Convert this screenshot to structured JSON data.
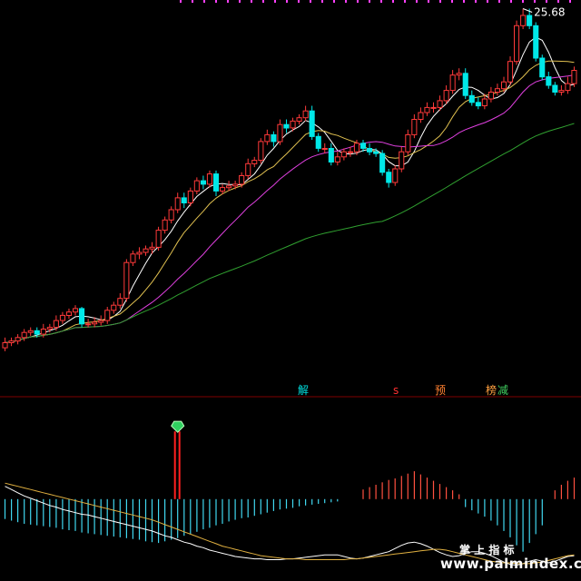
{
  "chart_data": [
    {
      "type": "candlestick",
      "title": "",
      "high_label": "25.68",
      "x": [
        1,
        2,
        3,
        4,
        5,
        6,
        7,
        8,
        9,
        10,
        11,
        12,
        13,
        14,
        15,
        16,
        17,
        18,
        19,
        20,
        21,
        22,
        23,
        24,
        25,
        26,
        27,
        28,
        29,
        30,
        31,
        32,
        33,
        34,
        35,
        36,
        37,
        38,
        39,
        40,
        41,
        42,
        43,
        44,
        45,
        46,
        47,
        48,
        49,
        50,
        51,
        52,
        53,
        54,
        55,
        56,
        57,
        58,
        59,
        60,
        61,
        62,
        63,
        64,
        65,
        66,
        67,
        68,
        69,
        70,
        71,
        72,
        73,
        74,
        75,
        76,
        77,
        78,
        79,
        80,
        81,
        82,
        83,
        84,
        85,
        86,
        87,
        88,
        89,
        90
      ],
      "series": [
        {
          "kind": "ohlc",
          "open": [
            9.4,
            9.7,
            9.8,
            10.0,
            10.3,
            10.4,
            10.2,
            10.5,
            10.6,
            11.0,
            11.3,
            11.5,
            11.7,
            10.8,
            10.8,
            10.9,
            11.0,
            11.6,
            11.9,
            12.3,
            14.4,
            14.9,
            15.0,
            15.2,
            15.3,
            16.3,
            16.9,
            17.5,
            18.2,
            17.9,
            18.6,
            19.2,
            19.0,
            19.6,
            18.6,
            18.8,
            18.9,
            19.0,
            19.5,
            20.2,
            20.4,
            21.5,
            21.9,
            21.5,
            22.5,
            22.3,
            22.7,
            22.9,
            23.3,
            21.8,
            21.1,
            21.1,
            20.3,
            20.6,
            20.9,
            20.9,
            21.4,
            21.1,
            20.9,
            20.8,
            19.7,
            19.1,
            19.9,
            20.9,
            21.9,
            22.8,
            23.2,
            23.5,
            23.5,
            23.9,
            24.5,
            25.4,
            25.5,
            24.2,
            23.8,
            23.6,
            24.0,
            24.4,
            24.6,
            25.0,
            26.2,
            28.3,
            28.9,
            28.3,
            26.4,
            25.3,
            24.8,
            24.4,
            24.5,
            24.9
          ],
          "close": [
            9.7,
            9.8,
            10.0,
            10.3,
            10.4,
            10.2,
            10.5,
            10.6,
            11.0,
            11.3,
            11.5,
            11.7,
            10.8,
            10.8,
            10.9,
            11.0,
            11.6,
            11.9,
            12.3,
            14.4,
            14.9,
            15.0,
            15.2,
            15.3,
            16.3,
            16.9,
            17.5,
            18.2,
            17.9,
            18.6,
            19.2,
            19.0,
            19.6,
            18.6,
            18.8,
            18.9,
            19.0,
            19.5,
            20.2,
            20.4,
            21.5,
            21.9,
            21.5,
            22.5,
            22.3,
            22.7,
            22.9,
            23.3,
            21.8,
            21.1,
            21.1,
            20.3,
            20.6,
            20.9,
            20.9,
            21.4,
            21.1,
            20.9,
            20.8,
            19.7,
            19.1,
            19.9,
            20.9,
            21.9,
            22.8,
            23.2,
            23.5,
            23.5,
            23.9,
            24.5,
            25.4,
            25.5,
            24.2,
            23.8,
            23.6,
            24.0,
            24.4,
            24.6,
            25.0,
            26.2,
            28.3,
            28.9,
            28.3,
            26.4,
            25.3,
            24.8,
            24.4,
            24.5,
            24.9,
            25.68
          ],
          "high": [
            10.0,
            10.0,
            10.2,
            10.5,
            10.6,
            10.6,
            10.8,
            10.8,
            11.3,
            11.5,
            11.7,
            11.9,
            11.8,
            11.1,
            11.2,
            11.3,
            11.8,
            12.1,
            12.6,
            14.6,
            15.1,
            15.3,
            15.4,
            15.6,
            16.5,
            17.1,
            17.7,
            18.5,
            18.5,
            18.8,
            19.4,
            19.5,
            19.8,
            19.8,
            19.0,
            19.2,
            19.2,
            19.7,
            20.5,
            20.6,
            21.7,
            22.2,
            22.1,
            22.8,
            22.8,
            22.9,
            23.1,
            23.6,
            23.6,
            22.0,
            21.4,
            21.4,
            20.9,
            21.1,
            21.2,
            21.6,
            21.6,
            21.4,
            21.1,
            21.0,
            19.9,
            20.1,
            21.2,
            22.2,
            23.1,
            23.5,
            23.8,
            23.8,
            24.2,
            24.8,
            25.7,
            25.8,
            25.8,
            24.5,
            24.1,
            24.3,
            24.7,
            24.9,
            25.3,
            26.5,
            28.6,
            29.3,
            29.3,
            28.5,
            26.6,
            25.6,
            25.0,
            24.8,
            25.3,
            25.9
          ],
          "low": [
            9.2,
            9.5,
            9.6,
            9.8,
            10.1,
            10.0,
            10.0,
            10.3,
            10.4,
            10.8,
            11.1,
            11.3,
            10.6,
            10.6,
            10.6,
            10.7,
            10.8,
            11.4,
            11.7,
            12.1,
            14.2,
            14.6,
            14.8,
            14.9,
            15.1,
            16.1,
            16.7,
            17.3,
            17.6,
            17.7,
            18.4,
            18.7,
            18.8,
            18.3,
            18.4,
            18.6,
            18.7,
            18.8,
            19.3,
            20.0,
            20.2,
            21.3,
            21.2,
            21.3,
            22.0,
            22.1,
            22.5,
            22.7,
            21.6,
            20.9,
            20.8,
            20.1,
            20.1,
            20.4,
            20.6,
            20.7,
            20.9,
            20.7,
            20.6,
            19.5,
            18.8,
            18.9,
            19.7,
            20.7,
            21.7,
            22.6,
            23.0,
            23.2,
            23.3,
            23.7,
            24.3,
            25.1,
            24.0,
            23.6,
            23.4,
            23.4,
            23.8,
            24.2,
            24.4,
            24.8,
            26.0,
            28.1,
            28.1,
            26.2,
            25.1,
            24.6,
            24.2,
            24.2,
            24.3,
            24.7
          ]
        },
        {
          "kind": "ma",
          "name": "",
          "color": "#ffffff",
          "period": 5
        },
        {
          "kind": "ma",
          "name": "",
          "color": "#e0c050",
          "period": 10
        },
        {
          "kind": "ma",
          "name": "",
          "color": "#e040e0",
          "period": 20
        },
        {
          "kind": "ma",
          "name": "",
          "color": "#30a030",
          "period": 60
        }
      ],
      "y_range": [
        8.5,
        29.7
      ],
      "grid": false,
      "colors": {
        "up": "#ff3a3a",
        "down": "#00e8e8",
        "background": "#000000"
      }
    },
    {
      "type": "bar",
      "title": "",
      "x": [
        1,
        2,
        3,
        4,
        5,
        6,
        7,
        8,
        9,
        10,
        11,
        12,
        13,
        14,
        15,
        16,
        17,
        18,
        19,
        20,
        21,
        22,
        23,
        24,
        25,
        26,
        27,
        28,
        29,
        30,
        31,
        32,
        33,
        34,
        35,
        36,
        37,
        38,
        39,
        40,
        41,
        42,
        43,
        44,
        45,
        46,
        47,
        48,
        49,
        50,
        51,
        52,
        53,
        54,
        55,
        56,
        57,
        58,
        59,
        60,
        61,
        62,
        63,
        64,
        65,
        66,
        67,
        68,
        69,
        70,
        71,
        72,
        73,
        74,
        75,
        76,
        77,
        78,
        79,
        80,
        81,
        82,
        83,
        84,
        85,
        86,
        87,
        88,
        89,
        90
      ],
      "values": [
        -2.5,
        -2.7,
        -2.9,
        -3.1,
        -3.2,
        -3.3,
        -3.4,
        -3.5,
        -3.6,
        -3.8,
        -3.9,
        -4.0,
        -4.2,
        -4.3,
        -4.4,
        -4.5,
        -4.6,
        -4.7,
        -4.8,
        -4.9,
        -5.0,
        -5.1,
        -5.3,
        -5.4,
        -5.5,
        -5.3,
        -5.1,
        -4.9,
        -4.6,
        -4.4,
        -4.1,
        -3.8,
        -3.6,
        -3.3,
        -3.1,
        -2.8,
        -2.6,
        -2.4,
        -2.3,
        -2.1,
        -1.9,
        -1.7,
        -1.5,
        -1.3,
        -1.2,
        -1.1,
        -0.9,
        -0.8,
        -0.7,
        -0.6,
        -0.5,
        -0.4,
        -0.3,
        0,
        0,
        0,
        1.2,
        1.5,
        1.8,
        2.1,
        2.4,
        2.6,
        2.9,
        3.2,
        3.5,
        3.1,
        2.7,
        2.3,
        1.9,
        1.5,
        1.1,
        0.6,
        -1.0,
        -1.4,
        -1.8,
        -2.2,
        -2.7,
        -3.3,
        -4.0,
        -4.8,
        -5.8,
        -6.6,
        -5.5,
        -4.4,
        -3.3,
        0,
        1.1,
        1.8,
        2.3,
        2.7
      ],
      "y_range": [
        -8,
        10
      ],
      "grid": false,
      "signal_bar": {
        "x": 28,
        "value": 8.5,
        "marker": "diamond-icon"
      },
      "line_series": [
        {
          "name": "",
          "color": "#ffffff",
          "values": [
            1.6,
            1.2,
            0.8,
            0.4,
            0.1,
            -0.2,
            -0.5,
            -0.8,
            -1.0,
            -1.3,
            -1.5,
            -1.7,
            -1.9,
            -2.0,
            -2.2,
            -2.4,
            -2.6,
            -2.8,
            -3.0,
            -3.2,
            -3.4,
            -3.6,
            -3.8,
            -4.0,
            -4.3,
            -4.6,
            -4.8,
            -5.1,
            -5.4,
            -5.6,
            -5.9,
            -6.1,
            -6.4,
            -6.6,
            -6.8,
            -7.0,
            -7.2,
            -7.3,
            -7.4,
            -7.5,
            -7.5,
            -7.6,
            -7.6,
            -7.6,
            -7.5,
            -7.5,
            -7.4,
            -7.3,
            -7.2,
            -7.1,
            -7.0,
            -7.0,
            -7.0,
            -7.2,
            -7.4,
            -7.5,
            -7.4,
            -7.2,
            -7.0,
            -6.8,
            -6.6,
            -6.2,
            -5.8,
            -5.5,
            -5.4,
            -5.6,
            -5.9,
            -6.3,
            -6.7,
            -7.0,
            -7.2,
            -7.1,
            -6.8,
            -6.6,
            -6.6,
            -6.8,
            -7.1,
            -7.5,
            -7.9,
            -8.2,
            -8.3,
            -8.1,
            -7.8,
            -7.6,
            -7.8,
            -8.0,
            -7.8,
            -7.5,
            -7.2,
            -7.1
          ]
        },
        {
          "name": "",
          "color": "#e0b040",
          "values": [
            2.0,
            1.8,
            1.6,
            1.4,
            1.2,
            1.0,
            0.8,
            0.6,
            0.4,
            0.2,
            0.0,
            -0.2,
            -0.4,
            -0.6,
            -0.8,
            -1.0,
            -1.2,
            -1.4,
            -1.6,
            -1.8,
            -2.0,
            -2.2,
            -2.4,
            -2.6,
            -2.9,
            -3.2,
            -3.5,
            -3.8,
            -4.1,
            -4.4,
            -4.7,
            -5.0,
            -5.3,
            -5.6,
            -5.9,
            -6.1,
            -6.3,
            -6.5,
            -6.7,
            -6.9,
            -7.1,
            -7.2,
            -7.3,
            -7.4,
            -7.5,
            -7.5,
            -7.5,
            -7.6,
            -7.6,
            -7.6,
            -7.6,
            -7.6,
            -7.6,
            -7.6,
            -7.5,
            -7.5,
            -7.4,
            -7.3,
            -7.2,
            -7.1,
            -7.0,
            -6.9,
            -6.8,
            -6.7,
            -6.6,
            -6.5,
            -6.4,
            -6.3,
            -6.3,
            -6.4,
            -6.6,
            -6.8,
            -7.0,
            -7.2,
            -7.4,
            -7.6,
            -7.8,
            -7.9,
            -8.0,
            -8.0,
            -8.1,
            -8.1,
            -8.1,
            -8.0,
            -7.9,
            -7.7,
            -7.5,
            -7.3,
            -7.1,
            -7.0
          ]
        }
      ],
      "colors": {
        "positive": "#ff5040",
        "negative": "#40d8f0"
      }
    }
  ],
  "signals": [
    {
      "text": "解",
      "color": "#00e0e0"
    },
    {
      "text": "s",
      "color": "#ff3030"
    },
    {
      "text": "预",
      "color": "#ff8030"
    },
    {
      "text": "榜",
      "color": "#ffa040"
    },
    {
      "text": "减",
      "color": "#40d060"
    }
  ],
  "watermark": {
    "cn": "掌 上 指 标",
    "url": "www.palmindex.com"
  },
  "colors": {
    "top_ticks": "#ff40ff",
    "separator": "#800000"
  }
}
